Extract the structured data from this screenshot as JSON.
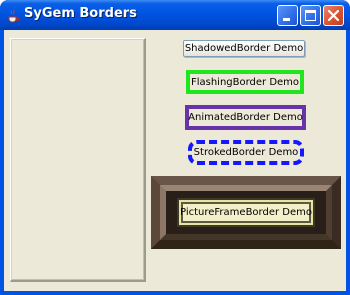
{
  "window": {
    "title": "SyGem Borders",
    "app_icon": "java-cup-icon",
    "controls": {
      "minimize_icon": "minimize-icon",
      "maximize_icon": "maximize-icon",
      "close_icon": "close-icon"
    }
  },
  "demos": {
    "shadowed": "ShadowedBorder Demo",
    "flashing": "FlashingBorder Demo",
    "animated": "AnimatedBorder Demo",
    "stroked": "StrokedBorder Demo",
    "picture": "PictureFrameBorder Demo"
  },
  "colors": {
    "titlebar_blue": "#0054e3",
    "flashing_border": "#1fe61f",
    "animated_border": "#6633a8",
    "stroked_border": "#1717ff",
    "panel_bg": "#ece9d8"
  }
}
